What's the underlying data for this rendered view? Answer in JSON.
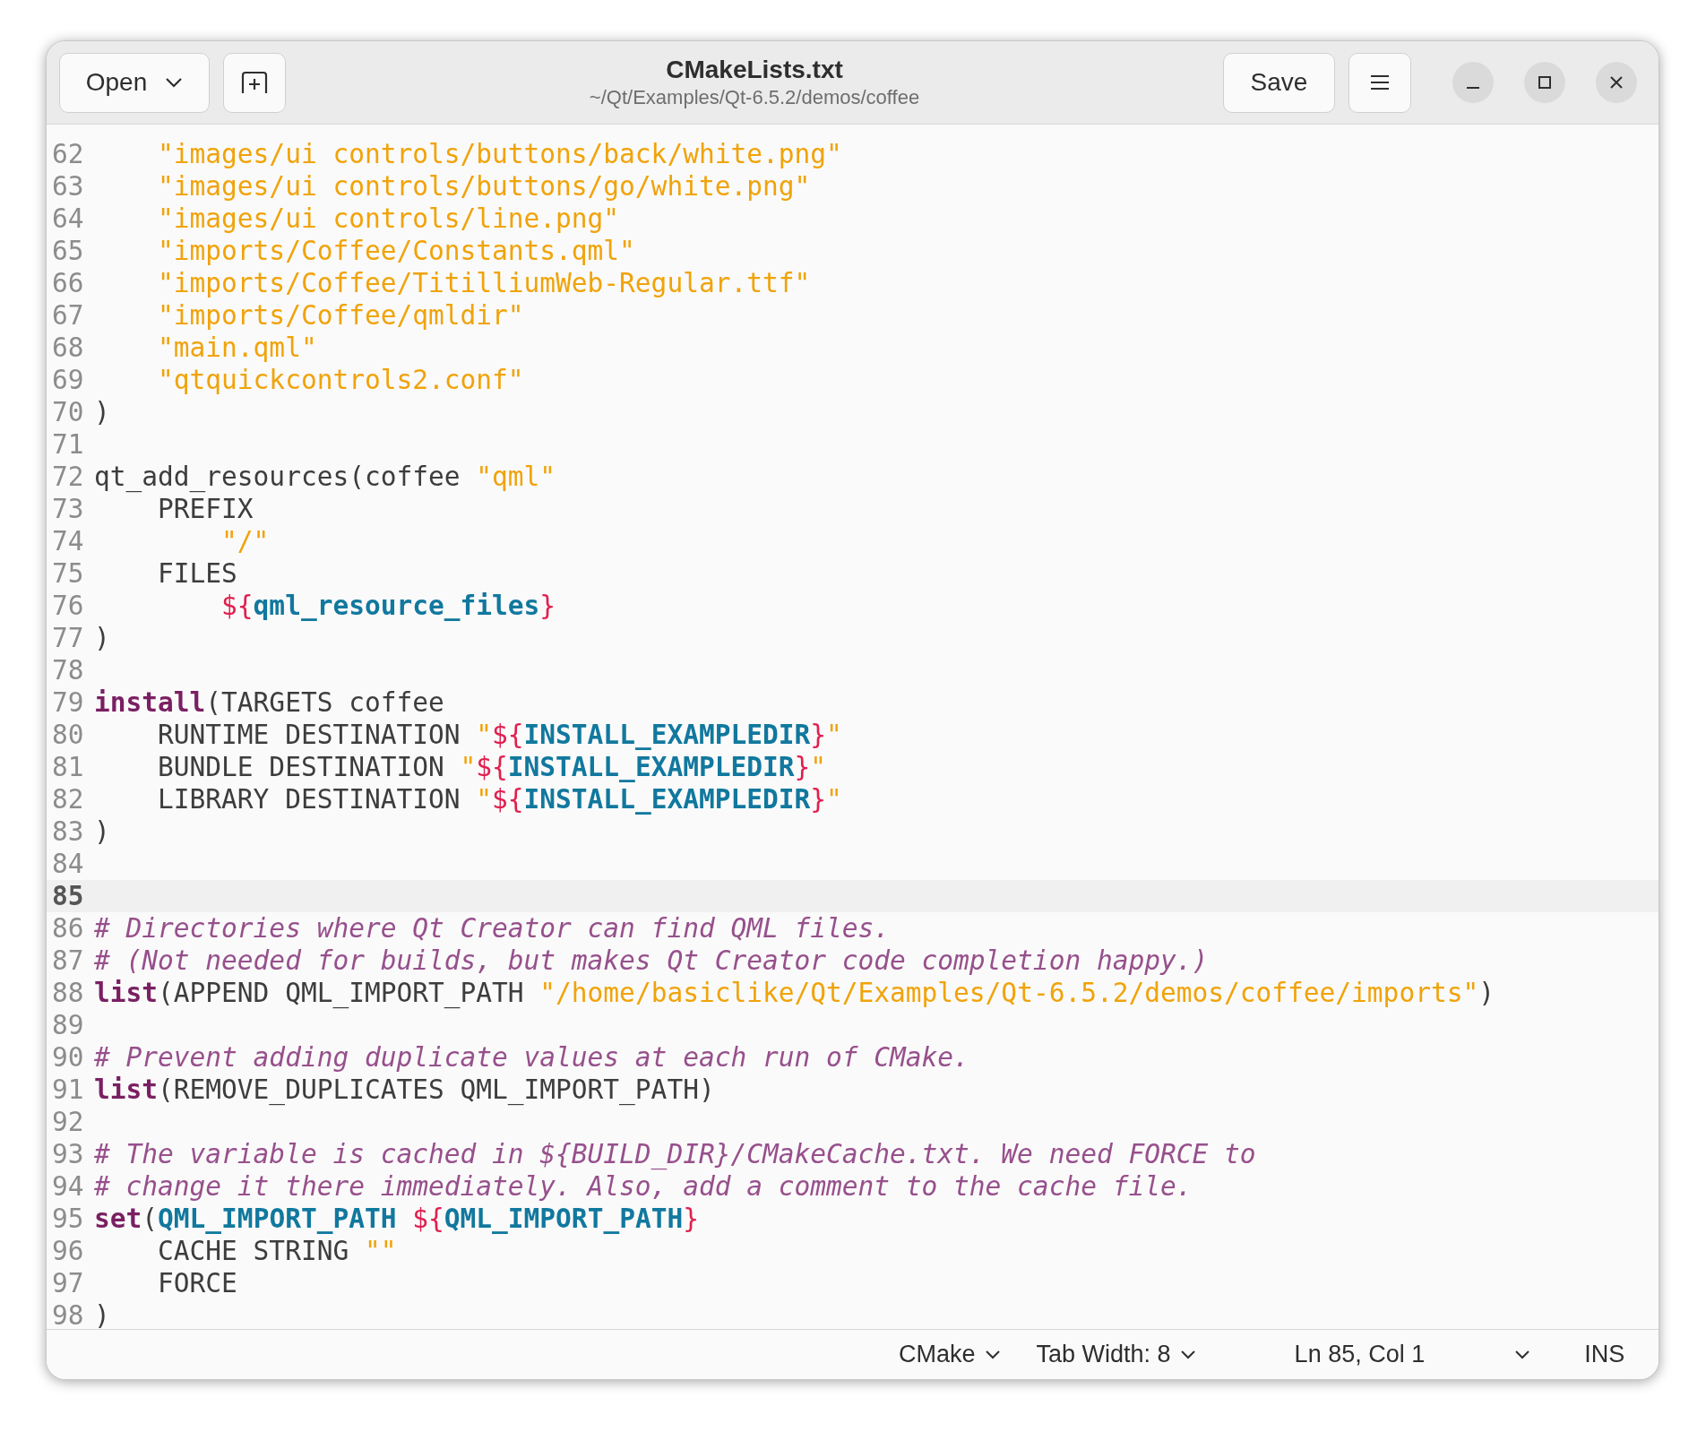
{
  "window": {
    "title": "CMakeLists.txt",
    "subtitle": "~/Qt/Examples/Qt-6.5.2/demos/coffee"
  },
  "header": {
    "open_button": "Open",
    "save_button": "Save"
  },
  "lines": [
    {
      "number": "62",
      "current": false,
      "tokens": [
        {
          "text": "    \"images/ui controls/buttons/back/white.png\"",
          "kind": "string"
        }
      ]
    },
    {
      "number": "63",
      "current": false,
      "tokens": [
        {
          "text": "    \"images/ui controls/buttons/go/white.png\"",
          "kind": "string"
        }
      ]
    },
    {
      "number": "64",
      "current": false,
      "tokens": [
        {
          "text": "    \"images/ui controls/line.png\"",
          "kind": "string"
        }
      ]
    },
    {
      "number": "65",
      "current": false,
      "tokens": [
        {
          "text": "    \"imports/Coffee/Constants.qml\"",
          "kind": "string"
        }
      ]
    },
    {
      "number": "66",
      "current": false,
      "tokens": [
        {
          "text": "    \"imports/Coffee/TitilliumWeb-Regular.ttf\"",
          "kind": "string"
        }
      ]
    },
    {
      "number": "67",
      "current": false,
      "tokens": [
        {
          "text": "    \"imports/Coffee/qmldir\"",
          "kind": "string"
        }
      ]
    },
    {
      "number": "68",
      "current": false,
      "tokens": [
        {
          "text": "    \"main.qml\"",
          "kind": "string"
        }
      ]
    },
    {
      "number": "69",
      "current": false,
      "tokens": [
        {
          "text": "    \"qtquickcontrols2.conf\"",
          "kind": "string"
        }
      ]
    },
    {
      "number": "70",
      "current": false,
      "tokens": [
        {
          "text": ")",
          "kind": "plain"
        }
      ]
    },
    {
      "number": "71",
      "current": false
    },
    {
      "number": "72",
      "current": false,
      "tokens": [
        {
          "text": "qt_add_resources(coffee ",
          "kind": "plain"
        },
        {
          "text": "\"qml\"",
          "kind": "string"
        }
      ]
    },
    {
      "number": "73",
      "current": false,
      "tokens": [
        {
          "text": "    PREFIX",
          "kind": "plain"
        }
      ]
    },
    {
      "number": "74",
      "current": false,
      "tokens": [
        {
          "text": "        \"/\"",
          "kind": "string"
        }
      ]
    },
    {
      "number": "75",
      "current": false,
      "tokens": [
        {
          "text": "    FILES",
          "kind": "plain"
        }
      ]
    },
    {
      "number": "76",
      "current": false,
      "tokens": [
        {
          "text": "        ${",
          "kind": "brace"
        },
        {
          "text": "qml_resource_files",
          "kind": "variable"
        },
        {
          "text": "}",
          "kind": "brace"
        }
      ]
    },
    {
      "number": "77",
      "current": false,
      "tokens": [
        {
          "text": ")",
          "kind": "plain"
        }
      ]
    },
    {
      "number": "78",
      "current": false
    },
    {
      "number": "79",
      "current": false,
      "tokens": [
        {
          "text": "install",
          "kind": "keyword"
        },
        {
          "text": "(TARGETS coffee",
          "kind": "plain"
        }
      ]
    },
    {
      "number": "80",
      "current": false,
      "tokens": [
        {
          "text": "    RUNTIME DESTINATION ",
          "kind": "plain"
        },
        {
          "text": "\"",
          "kind": "string"
        },
        {
          "text": "${",
          "kind": "brace"
        },
        {
          "text": "INSTALL_EXAMPLEDIR",
          "kind": "variable"
        },
        {
          "text": "}",
          "kind": "brace"
        },
        {
          "text": "\"",
          "kind": "string"
        }
      ]
    },
    {
      "number": "81",
      "current": false,
      "tokens": [
        {
          "text": "    BUNDLE DESTINATION ",
          "kind": "plain"
        },
        {
          "text": "\"",
          "kind": "string"
        },
        {
          "text": "${",
          "kind": "brace"
        },
        {
          "text": "INSTALL_EXAMPLEDIR",
          "kind": "variable"
        },
        {
          "text": "}",
          "kind": "brace"
        },
        {
          "text": "\"",
          "kind": "string"
        }
      ]
    },
    {
      "number": "82",
      "current": false,
      "tokens": [
        {
          "text": "    LIBRARY DESTINATION ",
          "kind": "plain"
        },
        {
          "text": "\"",
          "kind": "string"
        },
        {
          "text": "${",
          "kind": "brace"
        },
        {
          "text": "INSTALL_EXAMPLEDIR",
          "kind": "variable"
        },
        {
          "text": "}",
          "kind": "brace"
        },
        {
          "text": "\"",
          "kind": "string"
        }
      ]
    },
    {
      "number": "83",
      "current": false,
      "tokens": [
        {
          "text": ")",
          "kind": "plain"
        }
      ]
    },
    {
      "number": "84",
      "current": false
    },
    {
      "number": "85",
      "current": true
    },
    {
      "number": "86",
      "current": false,
      "tokens": [
        {
          "text": "# Directories where Qt Creator can find QML files.",
          "kind": "comment"
        }
      ]
    },
    {
      "number": "87",
      "current": false,
      "tokens": [
        {
          "text": "# (Not needed for builds, but makes Qt Creator code completion happy.)",
          "kind": "comment"
        }
      ]
    },
    {
      "number": "88",
      "current": false,
      "tokens": [
        {
          "text": "list",
          "kind": "keyword"
        },
        {
          "text": "(APPEND QML_IMPORT_PATH ",
          "kind": "plain"
        },
        {
          "text": "\"/home/basiclike/Qt/Examples/Qt-6.5.2/demos/coffee/imports\"",
          "kind": "string"
        },
        {
          "text": ")",
          "kind": "plain"
        }
      ]
    },
    {
      "number": "89",
      "current": false
    },
    {
      "number": "90",
      "current": false,
      "tokens": [
        {
          "text": "# Prevent adding duplicate values at each run of CMake.",
          "kind": "comment"
        }
      ]
    },
    {
      "number": "91",
      "current": false,
      "tokens": [
        {
          "text": "list",
          "kind": "keyword"
        },
        {
          "text": "(REMOVE_DUPLICATES QML_IMPORT_PATH)",
          "kind": "plain"
        }
      ]
    },
    {
      "number": "92",
      "current": false
    },
    {
      "number": "93",
      "current": false,
      "tokens": [
        {
          "text": "# The variable is cached in ${BUILD_DIR}/CMakeCache.txt. We need FORCE to",
          "kind": "comment"
        }
      ]
    },
    {
      "number": "94",
      "current": false,
      "tokens": [
        {
          "text": "# change it there immediately. Also, add a comment to the cache file.",
          "kind": "comment"
        }
      ]
    },
    {
      "number": "95",
      "current": false,
      "tokens": [
        {
          "text": "set",
          "kind": "keyword"
        },
        {
          "text": "(",
          "kind": "plain"
        },
        {
          "text": "QML_IMPORT_PATH",
          "kind": "variable"
        },
        {
          "text": " ${",
          "kind": "brace"
        },
        {
          "text": "QML_IMPORT_PATH",
          "kind": "variable"
        },
        {
          "text": "}",
          "kind": "brace"
        }
      ]
    },
    {
      "number": "96",
      "current": false,
      "tokens": [
        {
          "text": "    CACHE STRING ",
          "kind": "plain"
        },
        {
          "text": "\"\"",
          "kind": "string"
        }
      ]
    },
    {
      "number": "97",
      "current": false,
      "tokens": [
        {
          "text": "    FORCE",
          "kind": "plain"
        }
      ]
    },
    {
      "number": "98",
      "current": false,
      "tokens": [
        {
          "text": ")",
          "kind": "plain"
        }
      ]
    }
  ],
  "status_bar": {
    "language": "CMake",
    "tab_width": "Tab Width: 8",
    "position": "Ln 85, Col 1",
    "mode": "INS"
  }
}
